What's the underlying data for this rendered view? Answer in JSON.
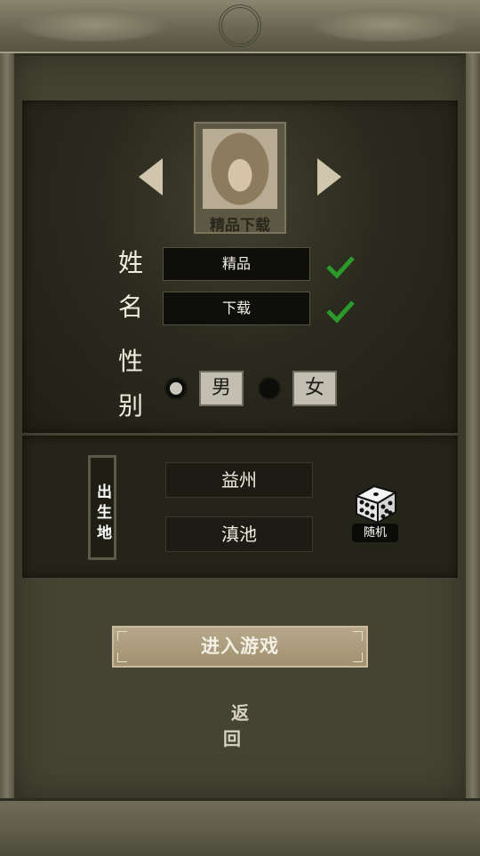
{
  "character": {
    "portrait_name": "精品下载"
  },
  "form": {
    "surname_label_char": "姓",
    "given_label_char": "名",
    "gender_label_top": "性",
    "gender_label_bottom": "别",
    "surname_value": "精品",
    "given_value": "下载",
    "gender_options": [
      "男",
      "女"
    ],
    "selected_gender": "男"
  },
  "origin": {
    "label": "出生地",
    "region": "益州",
    "city": "滇池",
    "random_label": "随机"
  },
  "actions": {
    "enter_label": "进入游戏",
    "back_label": "返 回"
  },
  "icons": [
    "arrow-left-icon",
    "arrow-right-icon",
    "check-icon",
    "dice-icon"
  ],
  "colors": {
    "check": "#2a9a2a",
    "enter_button": "#a8997a"
  }
}
